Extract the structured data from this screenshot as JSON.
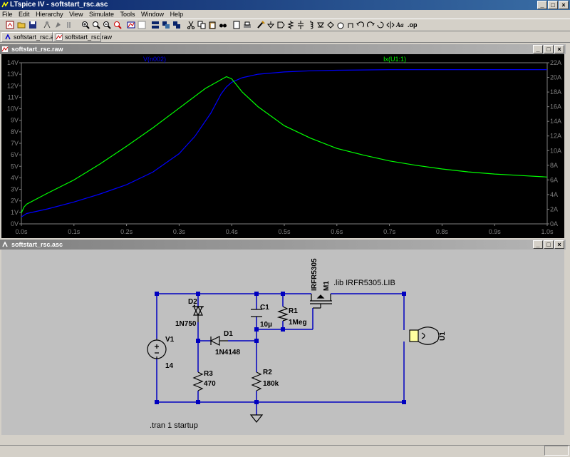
{
  "app": {
    "title": "LTspice IV - softstart_rsc.asc"
  },
  "menu": [
    "File",
    "Edit",
    "Hierarchy",
    "View",
    "Simulate",
    "Tools",
    "Window",
    "Help"
  ],
  "tabs": [
    {
      "label": "softstart_rsc.asc",
      "active": true
    },
    {
      "label": "softstart_rsc.raw",
      "active": false
    }
  ],
  "waveform_window": {
    "title": "softstart_rsc.raw"
  },
  "schematic_window": {
    "title": "softstart_rsc.asc"
  },
  "chart_data": {
    "type": "line",
    "title": "",
    "background": "#000000",
    "x_ticks": [
      "0.0s",
      "0.1s",
      "0.2s",
      "0.3s",
      "0.4s",
      "0.5s",
      "0.6s",
      "0.7s",
      "0.8s",
      "0.9s",
      "1.0s"
    ],
    "xlim": [
      0,
      1.0
    ],
    "y_left_ticks": [
      "0V",
      "1V",
      "2V",
      "3V",
      "4V",
      "5V",
      "6V",
      "7V",
      "8V",
      "9V",
      "10V",
      "11V",
      "12V",
      "13V",
      "14V"
    ],
    "ylim_left": [
      0,
      14
    ],
    "y_right_ticks": [
      "0A",
      "2A",
      "4A",
      "6A",
      "8A",
      "10A",
      "12A",
      "14A",
      "16A",
      "18A",
      "20A",
      "22A"
    ],
    "ylim_right": [
      0,
      22
    ],
    "series": [
      {
        "name": "V(n002)",
        "axis": "left",
        "color": "#0000ff",
        "x": [
          0,
          0.01,
          0.05,
          0.1,
          0.15,
          0.2,
          0.25,
          0.3,
          0.33,
          0.36,
          0.38,
          0.39,
          0.4,
          0.42,
          0.45,
          0.5,
          0.55,
          0.6,
          0.7,
          0.8,
          0.9,
          1.0
        ],
        "y": [
          0.6,
          0.9,
          1.3,
          1.9,
          2.6,
          3.4,
          4.5,
          6.1,
          7.6,
          9.6,
          11.3,
          11.9,
          12.3,
          12.7,
          13.0,
          13.2,
          13.3,
          13.35,
          13.4,
          13.4,
          13.4,
          13.4
        ]
      },
      {
        "name": "Ix(U1:1)",
        "axis": "right",
        "color": "#00ff00",
        "x": [
          0,
          0.005,
          0.01,
          0.05,
          0.1,
          0.15,
          0.2,
          0.25,
          0.3,
          0.35,
          0.39,
          0.4,
          0.42,
          0.45,
          0.5,
          0.55,
          0.6,
          0.65,
          0.7,
          0.75,
          0.8,
          0.85,
          0.9,
          0.95,
          1.0
        ],
        "y": [
          1.5,
          2.3,
          2.7,
          4.2,
          6.0,
          8.2,
          10.6,
          13.1,
          15.8,
          18.5,
          20.1,
          19.8,
          18.0,
          16.0,
          13.4,
          11.7,
          10.3,
          9.4,
          8.6,
          8.0,
          7.5,
          7.1,
          6.8,
          6.6,
          6.4
        ]
      }
    ]
  },
  "schematic": {
    "labels": {
      "d2": "D2",
      "d2_val": "1N750",
      "d1": "D1",
      "d1_val": "1N4148",
      "v1": "V1",
      "v1_val": "14",
      "r3": "R3",
      "r3_val": "470",
      "r2": "R2",
      "r2_val": "180k",
      "c1": "C1",
      "c1_val": "10µ",
      "r1": "R1",
      "r1_val": "1Meg",
      "m1": "M1",
      "m1_val": "IRFR5305",
      "u1": "U1",
      "lib": ".lib IRFR5305.LIB",
      "tran": ".tran 1 startup"
    }
  }
}
